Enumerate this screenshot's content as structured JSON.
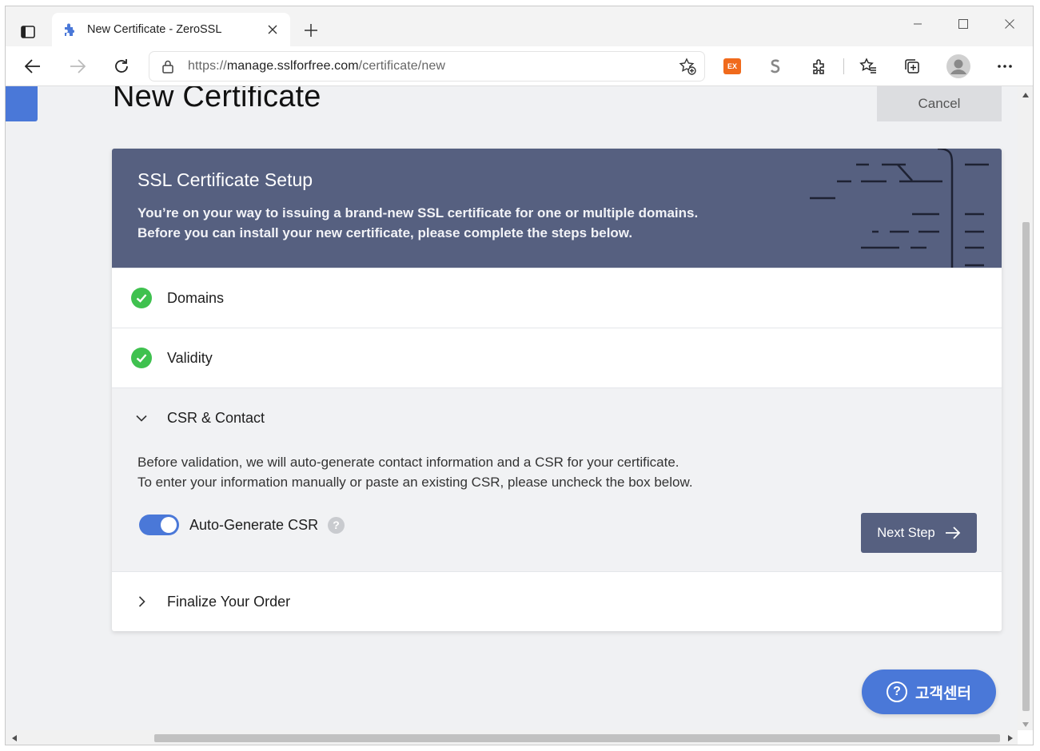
{
  "browser": {
    "tab_title": "New Certificate - ZeroSSL",
    "url_prefix": "https://",
    "url_host": "manage.sslforfree.com",
    "url_path": "/certificate/new",
    "icons": {
      "tab_actions": "tab-actions-icon",
      "favicon": "puzzle-favicon",
      "close": "close-icon",
      "new_tab": "plus-icon",
      "back": "back-arrow-icon",
      "forward": "forward-arrow-icon",
      "refresh": "refresh-icon",
      "lock": "lock-icon",
      "add_favorite": "add-favorite-icon",
      "extension_ex": "ex-extension-icon",
      "extension_s": "s-extension-icon",
      "extensions": "puzzle-icon",
      "favorites": "favorites-icon",
      "collections": "collections-icon",
      "profile": "profile-icon",
      "menu": "more-icon"
    },
    "ext_ex_label": "EX"
  },
  "page": {
    "title": "New Certificate",
    "cancel_label": "Cancel",
    "hero": {
      "heading": "SSL Certificate Setup",
      "line1": "You’re on your way to issuing a brand-new SSL certificate for one or multiple domains.",
      "line2": "Before you can install your new certificate, please complete the steps below."
    },
    "steps": [
      {
        "label": "Domains",
        "status": "complete"
      },
      {
        "label": "Validity",
        "status": "complete"
      },
      {
        "label": "CSR & Contact",
        "status": "active"
      },
      {
        "label": "Finalize Your Order",
        "status": "collapsed"
      }
    ],
    "csr": {
      "desc_line1": "Before validation, we will auto-generate contact information and a CSR for your certificate.",
      "desc_line2": "To enter your information manually or paste an existing CSR, please uncheck the box below.",
      "toggle_label": "Auto-Generate CSR",
      "toggle_on": true,
      "help_glyph": "?",
      "next_label": "Next Step"
    },
    "help_center": {
      "label": "고객센터",
      "glyph": "?"
    }
  },
  "colors": {
    "accent_blue": "#4a78d8",
    "hero_bg": "#566080",
    "check_green": "#3fc14f"
  }
}
